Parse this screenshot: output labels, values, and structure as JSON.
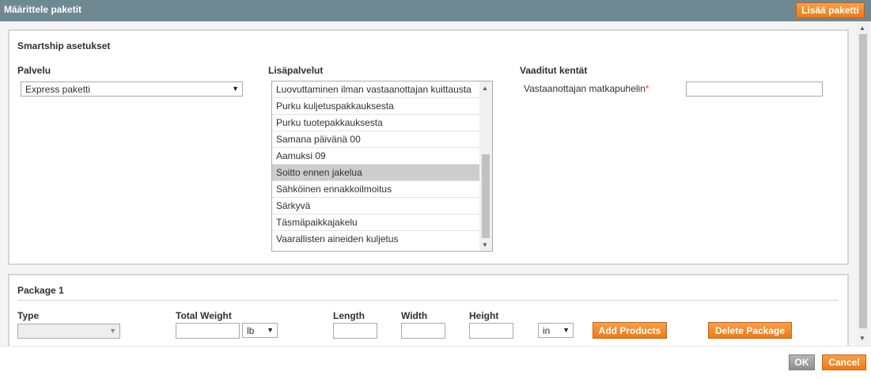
{
  "header": {
    "title": "Määrittele paketit",
    "add_package_label": "Lisää paketti"
  },
  "smartship": {
    "legend": "Smartship asetukset",
    "service_label": "Palvelu",
    "service_value": "Express paketti",
    "extra_label": "Lisäpalvelut",
    "extra_items": [
      {
        "label": "Luovuttaminen ilman vastaanottajan kuittausta",
        "selected": false
      },
      {
        "label": "Purku kuljetuspakkauksesta",
        "selected": false
      },
      {
        "label": "Purku tuotepakkauksesta",
        "selected": false
      },
      {
        "label": "Samana päivänä 00",
        "selected": false
      },
      {
        "label": "Aamuksi 09",
        "selected": false
      },
      {
        "label": "Soitto ennen jakelua",
        "selected": true
      },
      {
        "label": "Sähköinen ennakkoilmoitus",
        "selected": false
      },
      {
        "label": "Särkyvä",
        "selected": false
      },
      {
        "label": "Täsmäpaikkajakelu",
        "selected": false
      },
      {
        "label": "Vaarallisten aineiden kuljetus",
        "selected": false
      }
    ],
    "required_label": "Vaaditut kentät",
    "phone_label": "Vastaanottajan matkapuhelin",
    "required_marker": "*",
    "phone_value": ""
  },
  "package": {
    "legend": "Package 1",
    "type_label": "Type",
    "type_value": "",
    "total_weight_label": "Total Weight",
    "weight_value": "",
    "weight_unit": "lb",
    "length_label": "Length",
    "length_value": "",
    "width_label": "Width",
    "width_value": "",
    "height_label": "Height",
    "height_value": "",
    "dimension_unit": "in",
    "add_products_label": "Add Products",
    "delete_package_label": "Delete Package"
  },
  "footer": {
    "ok_label": "OK",
    "cancel_label": "Cancel"
  },
  "icons": {
    "dropdown": "▼",
    "scroll_up": "▲",
    "scroll_down": "▼"
  },
  "colors": {
    "header_bg": "#6f8992",
    "accent_orange": "#ee7a16",
    "required_star": "#eb5202",
    "selected_row": "#cdcdcd"
  }
}
